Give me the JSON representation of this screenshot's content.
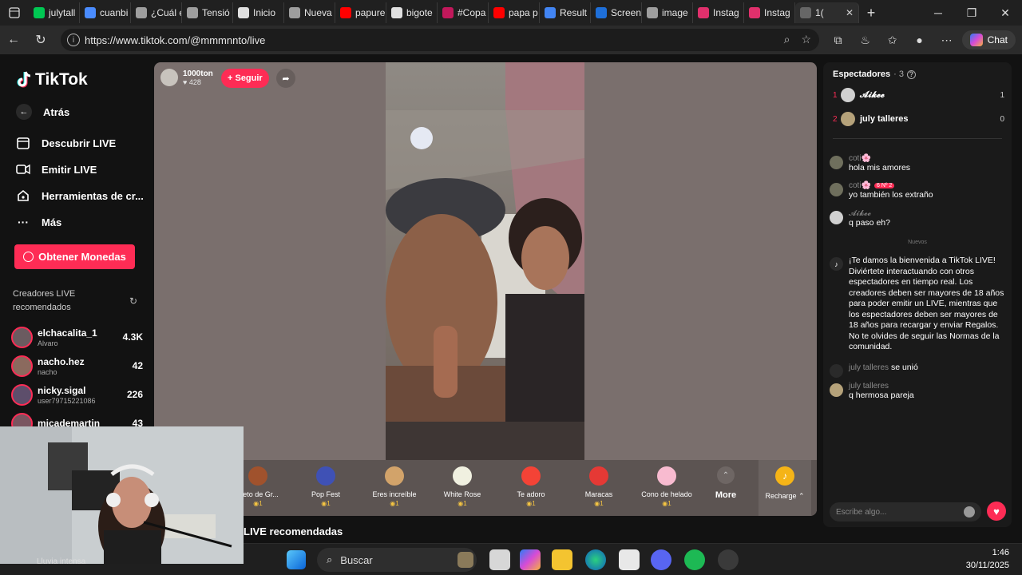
{
  "browser": {
    "tabs": [
      {
        "label": "julytall",
        "color": "#00c853"
      },
      {
        "label": "cuanbi",
        "color": "#4a8cff"
      },
      {
        "label": "¿Cuál e",
        "color": "#9e9e9e"
      },
      {
        "label": "Tensió",
        "color": "#9e9e9e"
      },
      {
        "label": "Inicio",
        "color": "#e0e0e0"
      },
      {
        "label": "Nueva",
        "color": "#9e9e9e"
      },
      {
        "label": "papure",
        "color": "#ff0000"
      },
      {
        "label": "bigote",
        "color": "#e0e0e0"
      },
      {
        "label": "#Copa",
        "color": "#c2185b"
      },
      {
        "label": "papa p",
        "color": "#ff0000"
      },
      {
        "label": "Result",
        "color": "#4285f4"
      },
      {
        "label": "Screen",
        "color": "#1e6fd9"
      },
      {
        "label": "image",
        "color": "#9e9e9e"
      },
      {
        "label": "Instag",
        "color": "#e1306c"
      },
      {
        "label": "Instag",
        "color": "#e1306c"
      },
      {
        "label": "1(",
        "color": "#666666",
        "active": true
      }
    ],
    "url": "https://www.tiktok.com/@mmmnnto/live",
    "chat_label": "Chat"
  },
  "sidebar": {
    "logo": "TikTok",
    "back": "Atrás",
    "nav": [
      {
        "label": "Descubrir LIVE",
        "icon": "calendar-icon"
      },
      {
        "label": "Emitir LIVE",
        "icon": "camera-icon"
      },
      {
        "label": "Herramientas de cr...",
        "icon": "home-icon"
      },
      {
        "label": "Más",
        "icon": "more-icon"
      }
    ],
    "coins_button": "Obtener Monedas",
    "recommended_title": "Creadores LIVE recomendados",
    "creators": [
      {
        "name": "elchacalita_1",
        "sub": "Alvaro",
        "count": "4.3K"
      },
      {
        "name": "nacho.hez",
        "sub": "nacho",
        "count": "42"
      },
      {
        "name": "nicky.sigal",
        "sub": "user79715221086",
        "count": "226"
      },
      {
        "name": "micademartin",
        "sub": "",
        "count": "43"
      }
    ]
  },
  "live": {
    "host_name": "1000ton",
    "host_likes": "428",
    "follow_label": "+ Seguir",
    "gifts": [
      {
        "name": "uleto de Gr...",
        "coins": "1",
        "color": "#a0522d"
      },
      {
        "name": "Pop Fest",
        "coins": "1",
        "color": "#3f51b5"
      },
      {
        "name": "Eres increíble",
        "coins": "1",
        "color": "#d2a36a"
      },
      {
        "name": "White Rose",
        "coins": "1",
        "color": "#f0f0e0"
      },
      {
        "name": "Te adoro",
        "coins": "1",
        "color": "#f44336"
      },
      {
        "name": "Maracas",
        "coins": "1",
        "color": "#e53935"
      },
      {
        "name": "Cono de helado",
        "coins": "1",
        "color": "#f8bbd0"
      }
    ],
    "more_label": "More",
    "recharge_label": "Recharge ⌃",
    "below_title": "LIVE recomendadas"
  },
  "chat": {
    "viewers_title": "Espectadores",
    "viewers_count": "· 3",
    "top_viewers": [
      {
        "rank": "1",
        "name": "𝓐𝓲𝓴𝓮𝓮",
        "score": "1"
      },
      {
        "rank": "2",
        "name": "july talleres",
        "score": "0"
      }
    ],
    "messages": [
      {
        "user": "coti🌸",
        "text": "hola mis amores",
        "badge": ""
      },
      {
        "user": "coti🌸",
        "text": "yo también los extraño",
        "badge": "6 Nº 2"
      },
      {
        "user": "𝓐𝓲𝓴𝓮𝓮",
        "text": "q paso eh?",
        "badge": ""
      }
    ],
    "new_label": "Nuevos",
    "welcome": "¡Te damos la bienvenida a TikTok LIVE! Diviértete interactuando con otros espectadores en tiempo real. Los creadores deben ser mayores de 18 años para poder emitir un LIVE, mientras que los espectadores deben ser mayores de 18 años para recargar y enviar Regalos. No te olvides de seguir las Normas de la comunidad.",
    "join": {
      "user": "july talleres",
      "text": "se unió"
    },
    "last_message": {
      "user": "july talleres",
      "text": "q hermosa pareja"
    },
    "input_placeholder": "Escribe algo..."
  },
  "webcam": {
    "caption": "Lluvia intensa"
  },
  "taskbar": {
    "search": "Buscar",
    "time": "1:46",
    "date": "30/11/2025"
  },
  "colors": {
    "accent": "#fe2c55",
    "background": "#121212",
    "video_bg": "#7a6f6d"
  }
}
